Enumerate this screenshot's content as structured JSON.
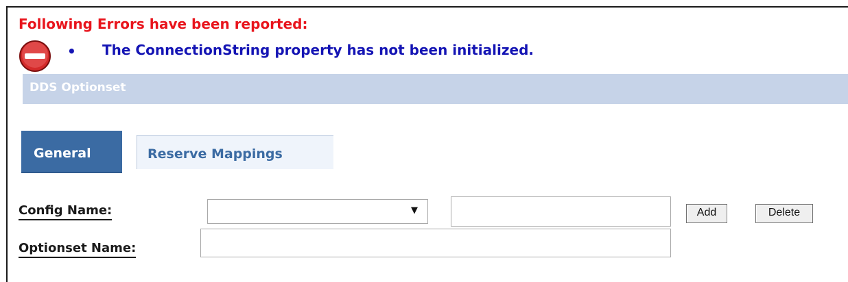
{
  "errors": {
    "heading": "Following Errors have been reported:",
    "bullet": "•",
    "messages": [
      "The ConnectionString property has not been initialized."
    ],
    "icon": "error-stop-icon",
    "heading_color": "#e8141c",
    "message_color": "#1414b4"
  },
  "section": {
    "title": "DDS Optionset",
    "bar_color": "#c6d3e8"
  },
  "tabs": [
    {
      "label": "General",
      "selected": true
    },
    {
      "label": "Reserve Mappings",
      "selected": false
    }
  ],
  "form": {
    "config_name_label": "Config Name:",
    "config_name_selected": "",
    "config_name_arrow": "▼",
    "new_config_value": "",
    "optionset_name_label": "Optionset Name:",
    "optionset_name_value": "",
    "add_label": "Add",
    "delete_label": "Delete"
  },
  "colors": {
    "tab_active_bg": "#3b6ba3",
    "tab_inactive_bg": "#eff4fb"
  }
}
